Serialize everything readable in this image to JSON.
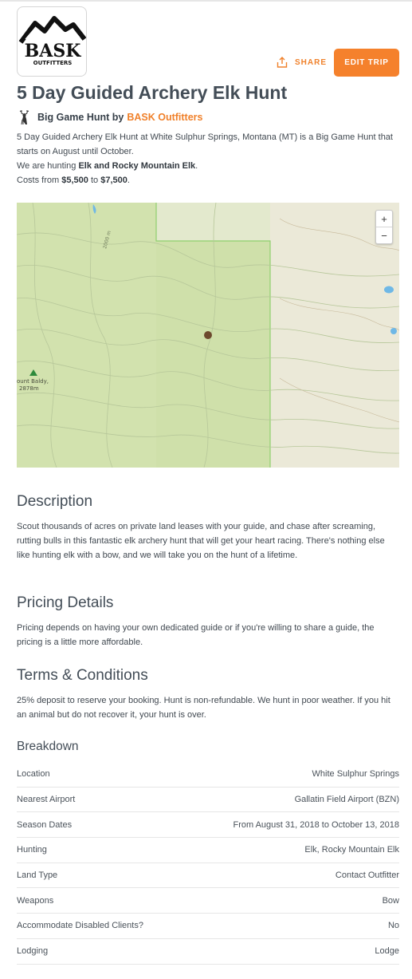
{
  "brand": {
    "logo_text": "BASK",
    "logo_subtext": "OUTFITTERS"
  },
  "header": {
    "share_label": "SHARE",
    "edit_label": "EDIT TRIP",
    "accent_color": "#f5812c"
  },
  "trip": {
    "title": "5 Day Guided Archery Elk Hunt",
    "category_icon": "deer-icon",
    "subtitle_prefix": "Big Game Hunt by",
    "outfitter": "BASK Outfitters",
    "summary_line1": "5 Day Guided Archery Elk Hunt at White Sulphur Springs, Montana (MT) is a Big Game Hunt that starts on August until October.",
    "hunting_prefix": "We are hunting",
    "hunting_species": "Elk and Rocky Mountain Elk",
    "costs_prefix": "Costs from",
    "cost_from": "$5,500",
    "cost_to_word": "to",
    "cost_to": "$7,500"
  },
  "map": {
    "zoom_in": "+",
    "zoom_out": "−",
    "contour_label": "2000 m",
    "peak_name": "ount Baldy,",
    "peak_elev": "2878m"
  },
  "description": {
    "heading": "Description",
    "text": "Scout thousands of acres on private land leases with your guide, and chase after screaming, rutting bulls in this fantastic elk archery hunt that will get your heart racing. There's nothing else like hunting elk with a bow, and we will take you on the hunt of a lifetime."
  },
  "pricing": {
    "heading": "Pricing Details",
    "text": "Pricing depends on having your own dedicated guide or if you're willing to share a guide, the pricing is a little more affordable."
  },
  "terms": {
    "heading": "Terms & Conditions",
    "text": "25% deposit to reserve your booking. Hunt is non-refundable. We hunt in poor weather. If you hit an animal but do not recover it, your hunt is over."
  },
  "breakdown": {
    "heading": "Breakdown",
    "rows": [
      {
        "label": "Location",
        "value": "White Sulphur Springs"
      },
      {
        "label": "Nearest Airport",
        "value": "Gallatin Field Airport (BZN)"
      },
      {
        "label": "Season Dates",
        "value": "From August 31, 2018 to October 13, 2018"
      },
      {
        "label": "Hunting",
        "value": "Elk, Rocky Mountain Elk"
      },
      {
        "label": "Land Type",
        "value": "Contact Outfitter"
      },
      {
        "label": "Weapons",
        "value": "Bow"
      },
      {
        "label": "Accommodate Disabled Clients?",
        "value": "No"
      },
      {
        "label": "Lodging",
        "value": "Lodge"
      }
    ]
  }
}
